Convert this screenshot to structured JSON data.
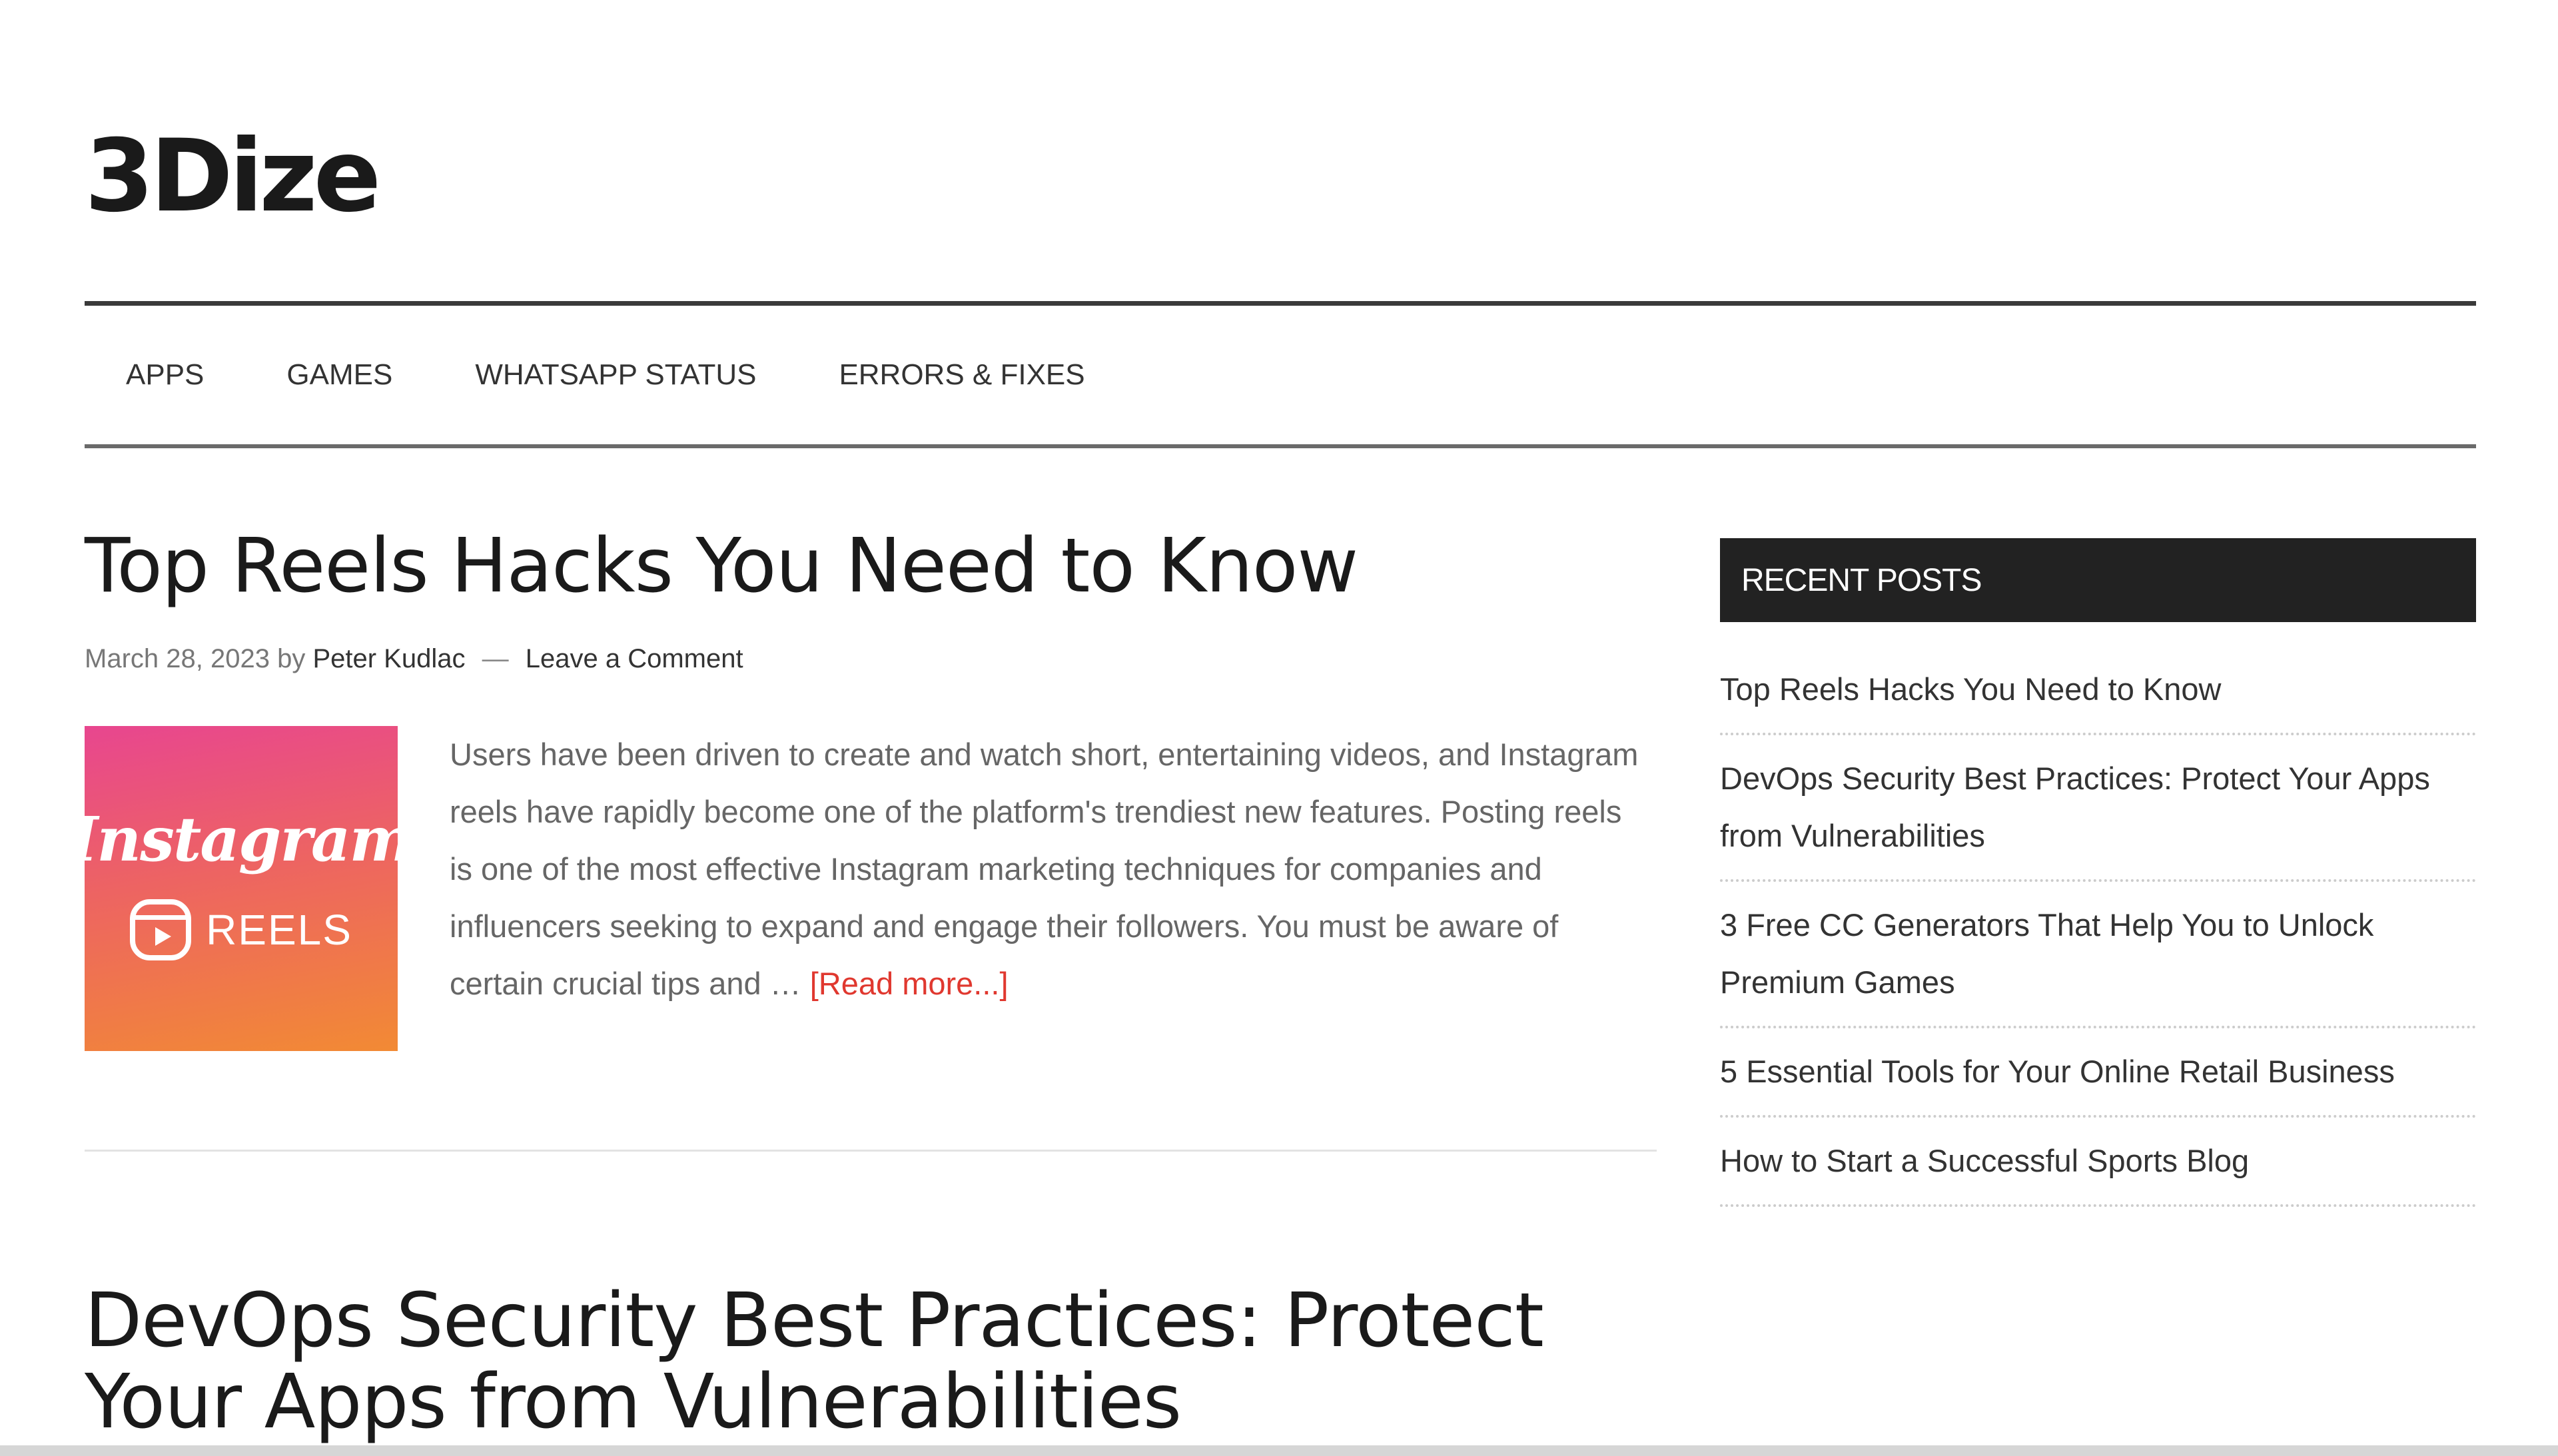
{
  "site": {
    "title": "3Dize"
  },
  "nav": {
    "items": [
      "APPS",
      "GAMES",
      "WHATSAPP STATUS",
      "ERRORS & FIXES"
    ]
  },
  "posts": [
    {
      "title": "Top Reels Hacks You Need to Know",
      "date": "March 28, 2023",
      "by": "by",
      "author": "Peter Kudlac",
      "separator": "—",
      "comments": "Leave a Comment",
      "thumbnail": {
        "word": "Instagram",
        "label": "REELS",
        "icon": "reels-icon"
      },
      "excerpt": "Users have been driven to create and watch short, entertaining videos, and Instagram reels have rapidly become one of the platform's trendiest new features. Posting reels is one of the most effective Instagram marketing techniques for companies and influencers seeking to expand and engage their followers.     You must be aware of certain crucial tips and …",
      "read_more": "[Read more...]"
    },
    {
      "title": "DevOps Security Best Practices: Protect Your Apps from Vulnerabilities"
    }
  ],
  "sidebar": {
    "widget_title": "RECENT POSTS",
    "recent_posts": [
      "Top Reels Hacks You Need to Know",
      "DevOps Security Best Practices: Protect Your Apps from Vulnerabilities",
      "3 Free CC Generators That Help You to Unlock Premium Games",
      "5 Essential Tools for Your Online Retail Business",
      "How to Start a Successful Sports Blog"
    ]
  },
  "colors": {
    "read_more": "#e0382f",
    "widget_bg": "#222222",
    "thumbnail_gradient_start": "#e8468f",
    "thumbnail_gradient_end": "#f28a34"
  }
}
